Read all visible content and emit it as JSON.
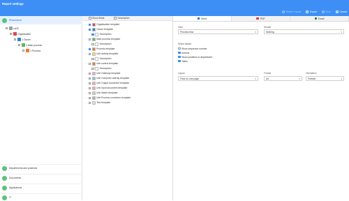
{
  "header": {
    "title": "Report settings",
    "actions": [
      {
        "label": "Restore layout",
        "enabled": false
      },
      {
        "label": "Export",
        "enabled": true
      },
      {
        "label": "Save",
        "enabled": false
      },
      {
        "label": "Cancel",
        "enabled": true
      }
    ]
  },
  "left": {
    "section_title": "Processes",
    "tree": [
      {
        "label": "xxHC",
        "level": 0,
        "checked": false,
        "color": "#9e9e9e"
      },
      {
        "label": "Organisation",
        "level": 1,
        "checked": false,
        "color": "#e0474c"
      },
      {
        "label": "1 Owner",
        "level": 2,
        "checked": false,
        "color": "#2f7fd8"
      },
      {
        "label": "1 Main process",
        "level": 3,
        "checked": false,
        "color": "#5cb85c"
      },
      {
        "label": "1 Process",
        "level": 4,
        "checked": false,
        "color": "#f07a2f"
      }
    ],
    "nav": [
      {
        "label": "Departments and positions",
        "color": "#5cc27a"
      },
      {
        "label": "Documents",
        "color": "#5cc27a"
      },
      {
        "label": "Applications",
        "color": "#5cc27a"
      },
      {
        "label": "IT",
        "color": "#5cc27a"
      }
    ]
  },
  "middle": {
    "header": {
      "show_fields": "Show fields",
      "description": "Description"
    },
    "rows": [
      {
        "label": "Organisation template",
        "checked": true,
        "color": "#e0474c",
        "indent": 0
      },
      {
        "label": "Owner template",
        "checked": true,
        "color": "#2f7fd8",
        "indent": 0
      },
      {
        "label": "Description",
        "checked": true,
        "color": "#ffffff",
        "indent": 1
      },
      {
        "label": "Main process template",
        "checked": false,
        "color": "#5cb85c",
        "indent": 0
      },
      {
        "label": "Description",
        "checked": false,
        "color": "#ffffff",
        "indent": 1
      },
      {
        "label": "Process template",
        "checked": true,
        "color": "#f07a2f",
        "indent": 0
      },
      {
        "label": "Unit activity template",
        "checked": false,
        "color": "#f5d76e",
        "indent": 0
      },
      {
        "label": "Description",
        "checked": false,
        "color": "#ffffff",
        "indent": 1
      },
      {
        "label": "Unit control template",
        "checked": false,
        "color": "#f07a2f",
        "indent": 0
      },
      {
        "label": "Description",
        "checked": false,
        "color": "#ffffff",
        "indent": 1
      },
      {
        "label": "Unit Gateway template",
        "checked": false,
        "color": "#f5a6c8",
        "indent": 0
      },
      {
        "label": "Unit Computer activity template",
        "checked": false,
        "color": "#7ec8e3",
        "indent": 0
      },
      {
        "label": "Unit Output document template",
        "checked": false,
        "color": "#f5a6a6",
        "indent": 0
      },
      {
        "label": "Unit Input document template",
        "checked": false,
        "color": "#f5a6a6",
        "indent": 0
      },
      {
        "label": "Unit Watch template",
        "checked": false,
        "color": "#cccccc",
        "indent": 0
      },
      {
        "label": "Unit Process connector template",
        "checked": false,
        "color": "#b0b0b0",
        "indent": 0
      },
      {
        "label": "Text template",
        "checked": false,
        "color": "#dddddd",
        "indent": 0
      }
    ]
  },
  "right": {
    "tabs": [
      {
        "label": "Word",
        "active": true,
        "color": "#2f6fd8"
      },
      {
        "label": "PDF",
        "active": false,
        "color": "#e03a3a"
      },
      {
        "label": "Excel",
        "active": false,
        "color": "#1f8a4c"
      }
    ],
    "view_label": "View",
    "view_value": "Process flow",
    "header_label": "Header",
    "header_value": "Nothing",
    "select_details": "Select details",
    "options": [
      {
        "label": "Show sequence number",
        "checked": false
      },
      {
        "label": "Actions",
        "checked": true
      },
      {
        "label": "Show positions & department",
        "checked": true
      },
      {
        "label": "Tasks",
        "checked": true
      }
    ],
    "layout_label": "Layout",
    "layout_value": "Flow on one page",
    "format_label": "Format",
    "format_value": "A4",
    "orientation_label": "Orientation",
    "orientation_value": "Portrait"
  }
}
